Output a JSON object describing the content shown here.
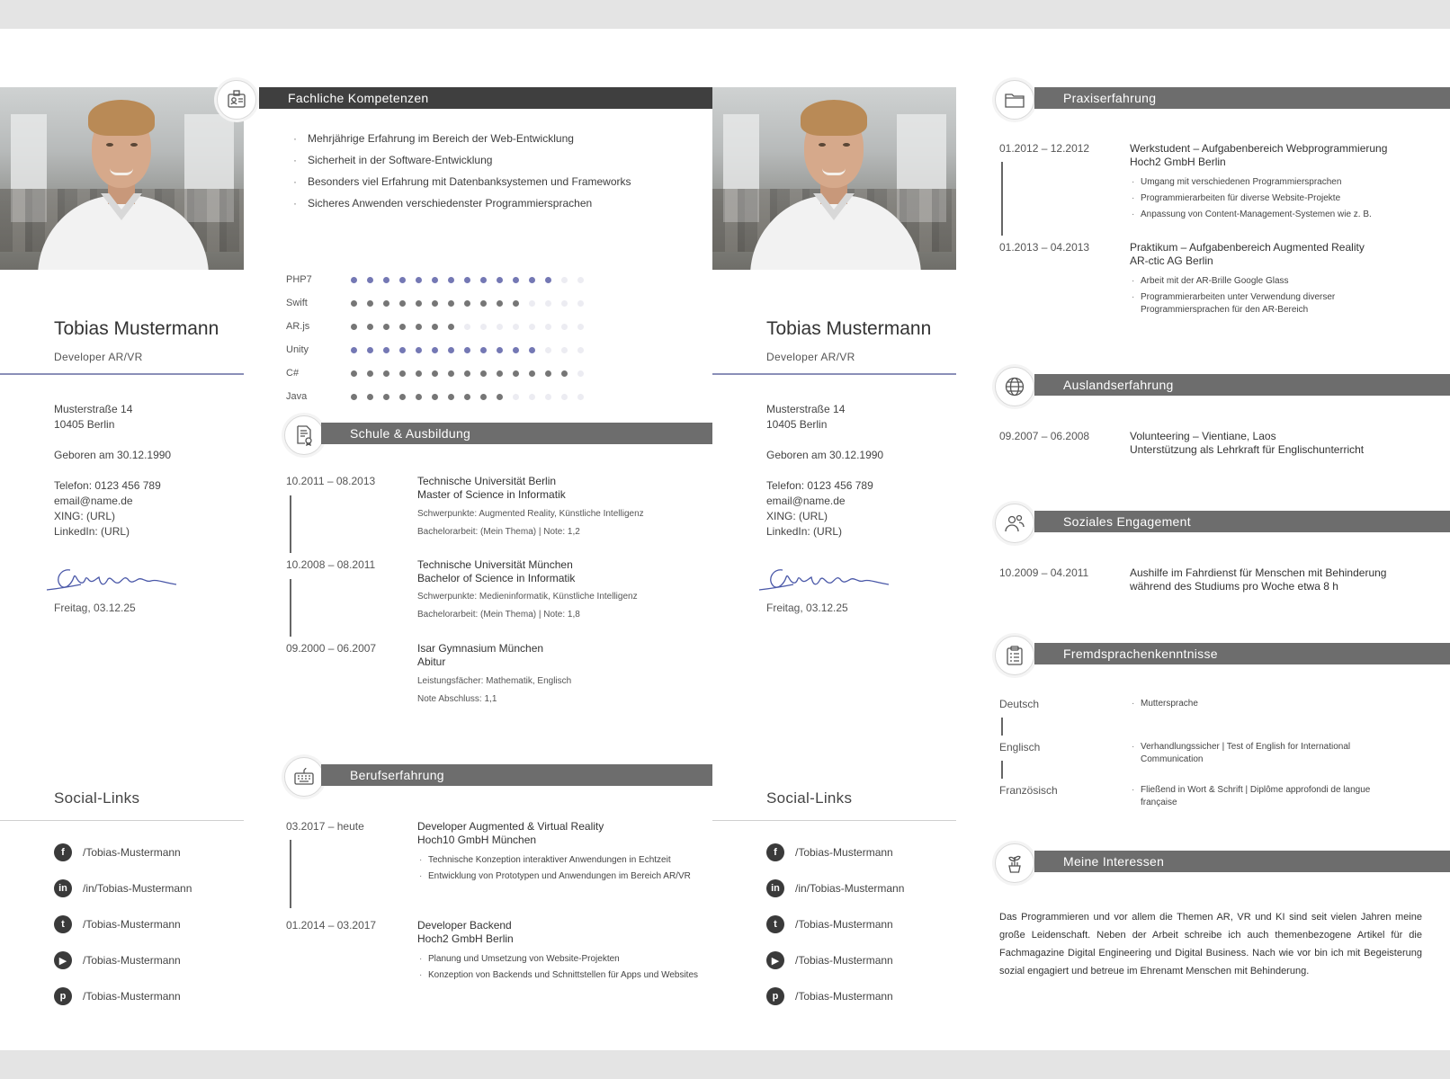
{
  "profile": {
    "name": "Tobias Mustermann",
    "role": "Developer AR/VR",
    "street": "Musterstraße 14",
    "city": "10405 Berlin",
    "birth": "Geboren am 30.12.1990",
    "phone": "Telefon: 0123 456 789",
    "email": "email@name.de",
    "xing": "XING: (URL)",
    "linkedin": "LinkedIn: (URL)",
    "signature_date": "Freitag, 03.12.25"
  },
  "social": {
    "title": "Social-Links",
    "items": [
      {
        "icon": "facebook-icon",
        "glyph": "f",
        "label": "/Tobias-Mustermann"
      },
      {
        "icon": "linkedin-icon",
        "glyph": "in",
        "label": "/in/Tobias-Mustermann"
      },
      {
        "icon": "twitter-icon",
        "glyph": "t",
        "label": "/Tobias-Mustermann"
      },
      {
        "icon": "youtube-icon",
        "glyph": "▶",
        "label": "/Tobias-Mustermann"
      },
      {
        "icon": "pinterest-icon",
        "glyph": "p",
        "label": "/Tobias-Mustermann"
      }
    ]
  },
  "competencies": {
    "title": "Fachliche Kompetenzen",
    "items": [
      "Mehrjährige Erfahrung im Bereich der Web-Entwicklung",
      "Sicherheit in der Software-Entwicklung",
      "Besonders viel Erfahrung mit Datenbanksystemen und Frameworks",
      "Sicheres Anwenden verschiedenster Programmiersprachen"
    ],
    "skills": [
      {
        "label": "PHP7",
        "level": 13,
        "max": 15,
        "color": "#7478b4"
      },
      {
        "label": "Swift",
        "level": 11,
        "max": 15,
        "color": "#767676"
      },
      {
        "label": "AR.js",
        "level": 7,
        "max": 15,
        "color": "#767676"
      },
      {
        "label": "Unity",
        "level": 12,
        "max": 15,
        "color": "#7478b4"
      },
      {
        "label": "C#",
        "level": 14,
        "max": 15,
        "color": "#767676"
      },
      {
        "label": "Java",
        "level": 10,
        "max": 15,
        "color": "#767676"
      }
    ]
  },
  "education": {
    "title": "Schule & Ausbildung",
    "entries": [
      {
        "date": "10.2011 – 08.2013",
        "line1": "Technische Universität Berlin",
        "line2": "Master of Science in Informatik",
        "note1": "Schwerpunkte: Augmented Reality, Künstliche Intelligenz",
        "note2": "Bachelorarbeit: (Mein Thema) | Note: 1,2"
      },
      {
        "date": "10.2008 – 08.2011",
        "line1": "Technische Universität München",
        "line2": "Bachelor of Science in Informatik",
        "note1": "Schwerpunkte: Medieninformatik, Künstliche Intelligenz",
        "note2": "Bachelorarbeit: (Mein Thema) | Note: 1,8"
      },
      {
        "date": "09.2000 – 06.2007",
        "line1": "Isar Gymnasium München",
        "line2": "Abitur",
        "note1": "Leistungsfächer: Mathematik, Englisch",
        "note2": "Note Abschluss: 1,1"
      }
    ]
  },
  "work": {
    "title": "Berufserfahrung",
    "entries": [
      {
        "date": "03.2017 – heute",
        "line1": "Developer Augmented & Virtual Reality",
        "line2": "Hoch10 GmbH München",
        "bullets": [
          "Technische Konzeption interaktiver Anwendungen in Echtzeit",
          "Entwicklung von Prototypen und Anwendungen im Bereich AR/VR"
        ]
      },
      {
        "date": "01.2014 – 03.2017",
        "line1": "Developer Backend",
        "line2": "Hoch2 GmbH Berlin",
        "bullets": [
          "Planung und Umsetzung von Website-Projekten",
          "Konzeption von Backends und Schnittstellen für Apps und Websites"
        ]
      }
    ]
  },
  "practice": {
    "title": "Praxiserfahrung",
    "entries": [
      {
        "date": "01.2012 – 12.2012",
        "line1": "Werkstudent – Aufgabenbereich Webprogrammierung",
        "line2": "Hoch2 GmbH Berlin",
        "bullets": [
          "Umgang mit verschiedenen Programmiersprachen",
          "Programmierarbeiten für diverse Website-Projekte",
          "Anpassung von Content-Management-Systemen wie z. B."
        ]
      },
      {
        "date": "01.2013 – 04.2013",
        "line1": "Praktikum – Aufgabenbereich Augmented Reality",
        "line2": "AR-ctic AG Berlin",
        "bullets": [
          "Arbeit mit  der AR-Brille Google Glass",
          "Programmierarbeiten unter Verwendung diverser Programmiersprachen für den AR-Bereich"
        ]
      }
    ]
  },
  "abroad": {
    "title": "Auslandserfahrung",
    "date": "09.2007 – 06.2008",
    "line1": "Volunteering – Vientiane, Laos",
    "line2": "Unterstützung als Lehrkraft für Englischunterricht"
  },
  "social_engagement": {
    "title": "Soziales Engagement",
    "date": "10.2009 – 04.2011",
    "line1": "Aushilfe im Fahrdienst für Menschen mit Behinderung",
    "line2": "während des Studiums pro Woche etwa 8 h"
  },
  "languages": {
    "title": "Fremdsprachenkenntnisse",
    "entries": [
      {
        "lang": "Deutsch",
        "level": "Muttersprache"
      },
      {
        "lang": "Englisch",
        "level": "Verhandlungssicher | Test of English for International Communication"
      },
      {
        "lang": "Französisch",
        "level": "Fließend in Wort & Schrift | Diplôme approfondi de langue française"
      }
    ]
  },
  "interests": {
    "title": "Meine Interessen",
    "text": "Das Programmieren und vor allem die Themen AR, VR und KI sind seit vielen Jahren meine große Leidenschaft. Neben der Arbeit schreibe ich auch themenbezogene Artikel für die Fachmagazine Digital Engineering und Digital Business. Nach wie vor bin ich mit Begeisterung sozial engagiert und betreue im Ehrenamt Menschen mit Behinderung."
  },
  "colors": {
    "accent": "#7478b4",
    "bar": "#6d6d6d",
    "bar_dark": "#3f3f3f",
    "dot_empty": "#ececf2"
  }
}
